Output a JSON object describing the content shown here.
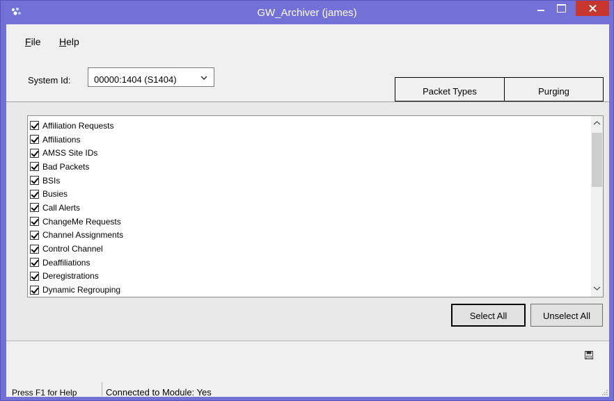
{
  "window": {
    "title": "GW_Archiver (james)"
  },
  "menu": {
    "file": {
      "mnemonic": "F",
      "rest": "ile"
    },
    "help": {
      "mnemonic": "H",
      "rest": "elp"
    }
  },
  "system_id": {
    "label": "System Id:",
    "value": "00000:1404 (S1404)"
  },
  "tabs": {
    "packet_types": "Packet Types",
    "purging": "Purging"
  },
  "packet_types": [
    {
      "label": "Affiliation Requests",
      "checked": true
    },
    {
      "label": "Affiliations",
      "checked": true
    },
    {
      "label": "AMSS Site IDs",
      "checked": true
    },
    {
      "label": "Bad Packets",
      "checked": true
    },
    {
      "label": "BSIs",
      "checked": true
    },
    {
      "label": "Busies",
      "checked": true
    },
    {
      "label": "Call Alerts",
      "checked": true
    },
    {
      "label": "ChangeMe Requests",
      "checked": true
    },
    {
      "label": "Channel Assignments",
      "checked": true
    },
    {
      "label": "Control Channel",
      "checked": true
    },
    {
      "label": "Deaffiliations",
      "checked": true
    },
    {
      "label": "Deregistrations",
      "checked": true
    },
    {
      "label": "Dynamic Regrouping",
      "checked": true
    }
  ],
  "buttons": {
    "select_all": "Select All",
    "unselect_all": "Unselect All"
  },
  "status": {
    "help": "Press F1 for Help",
    "connection": "Connected to Module: Yes"
  },
  "colors": {
    "title_bar": "#7370d8",
    "close_button": "#c7372f",
    "client": "#f0f0f0"
  }
}
